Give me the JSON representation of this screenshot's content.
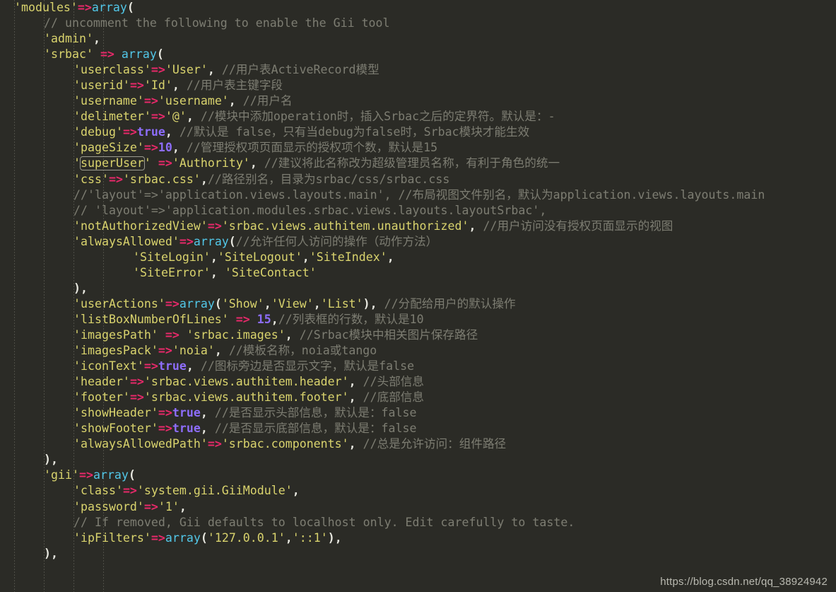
{
  "editor": {
    "background_color": "#2b2b26",
    "watermark": "https://blog.csdn.net/qq_38924942",
    "highlighted_token": "superUser",
    "colors": {
      "string": "#d9d36d",
      "operator": "#e8296a",
      "function": "#52c7e8",
      "keyword": "#8d6dfb",
      "number": "#8d6dfb",
      "comment": "#7d7d72",
      "punctuation": "#e8e8e0",
      "background": "#2b2b26"
    },
    "lines": [
      {
        "n": 1,
        "indent": 0,
        "text": "'modules'=>array("
      },
      {
        "n": 2,
        "indent": 1,
        "text": "// uncomment the following to enable the Gii tool"
      },
      {
        "n": 3,
        "indent": 1,
        "text": "'admin',"
      },
      {
        "n": 4,
        "indent": 1,
        "text": "'srbac' => array("
      },
      {
        "n": 5,
        "indent": 2,
        "text": "'userclass'=>'User', //用户表ActiveRecord模型"
      },
      {
        "n": 6,
        "indent": 2,
        "text": "'userid'=>'Id', //用户表主键字段"
      },
      {
        "n": 7,
        "indent": 2,
        "text": "'username'=>'username', //用户名"
      },
      {
        "n": 8,
        "indent": 2,
        "text": "'delimeter'=>'@', //模块中添加operation时，插入Srbac之后的定界符。默认是：-"
      },
      {
        "n": 9,
        "indent": 2,
        "text": "'debug'=>true, //默认是 false，只有当debug为false时，Srbac模块才能生效"
      },
      {
        "n": 10,
        "indent": 2,
        "text": "'pageSize'=>10, //管理授权项页面显示的授权项个数，默认是15"
      },
      {
        "n": 11,
        "indent": 2,
        "text": "'superUser' =>'Authority', //建议将此名称改为超级管理员名称，有利于角色的统一"
      },
      {
        "n": 12,
        "indent": 2,
        "text": "'css'=>'srbac.css',//路径别名，目录为srbac/css/srbac.css"
      },
      {
        "n": 13,
        "indent": 2,
        "text": "//'layout'=>'application.views.layouts.main', //布局视图文件别名，默认为application.views.layouts.main"
      },
      {
        "n": 14,
        "indent": 2,
        "text": "// 'layout'=>'application.modules.srbac.views.layouts.layoutSrbac',"
      },
      {
        "n": 15,
        "indent": 2,
        "text": "'notAuthorizedView'=>'srbac.views.authitem.unauthorized', //用户访问没有授权页面显示的视图"
      },
      {
        "n": 16,
        "indent": 2,
        "text": "'alwaysAllowed'=>array(//允许任何人访问的操作（动作方法）"
      },
      {
        "n": 17,
        "indent": 4,
        "text": "'SiteLogin','SiteLogout','SiteIndex',"
      },
      {
        "n": 18,
        "indent": 4,
        "text": "'SiteError', 'SiteContact'"
      },
      {
        "n": 19,
        "indent": 2,
        "text": "),"
      },
      {
        "n": 20,
        "indent": 2,
        "text": "'userActions'=>array('Show','View','List'), //分配给用户的默认操作"
      },
      {
        "n": 21,
        "indent": 2,
        "text": "'listBoxNumberOfLines' => 15,//列表框的行数，默认是10"
      },
      {
        "n": 22,
        "indent": 2,
        "text": "'imagesPath' => 'srbac.images', //Srbac模块中相关图片保存路径"
      },
      {
        "n": 23,
        "indent": 2,
        "text": "'imagesPack'=>'noia', //模板名称，noia或tango"
      },
      {
        "n": 24,
        "indent": 2,
        "text": "'iconText'=>true, //图标旁边是否显示文字，默认是false"
      },
      {
        "n": 25,
        "indent": 2,
        "text": "'header'=>'srbac.views.authitem.header', //头部信息"
      },
      {
        "n": 26,
        "indent": 2,
        "text": "'footer'=>'srbac.views.authitem.footer', //底部信息"
      },
      {
        "n": 27,
        "indent": 2,
        "text": "'showHeader'=>true, //是否显示头部信息，默认是：false"
      },
      {
        "n": 28,
        "indent": 2,
        "text": "'showFooter'=>true, //是否显示底部信息，默认是：false"
      },
      {
        "n": 29,
        "indent": 2,
        "text": "'alwaysAllowedPath'=>'srbac.components', //总是允许访问：组件路径"
      },
      {
        "n": 30,
        "indent": 1,
        "text": "),"
      },
      {
        "n": 31,
        "indent": 1,
        "text": "'gii'=>array("
      },
      {
        "n": 32,
        "indent": 2,
        "text": "'class'=>'system.gii.GiiModule',"
      },
      {
        "n": 33,
        "indent": 2,
        "text": "'password'=>'1',"
      },
      {
        "n": 34,
        "indent": 2,
        "text": "// If removed, Gii defaults to localhost only. Edit carefully to taste."
      },
      {
        "n": 35,
        "indent": 2,
        "text": "'ipFilters'=>array('127.0.0.1','::1'),"
      },
      {
        "n": 36,
        "indent": 1,
        "text": "),"
      }
    ]
  }
}
